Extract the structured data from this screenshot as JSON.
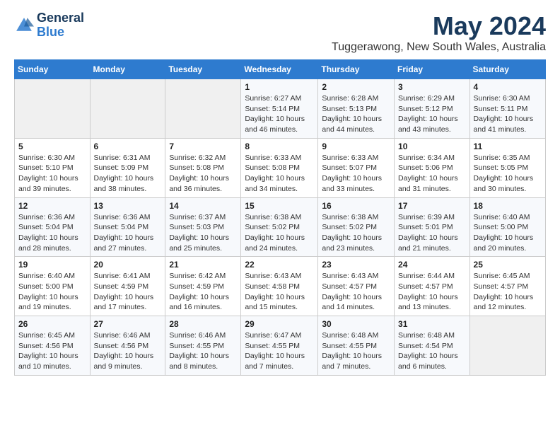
{
  "header": {
    "logo_line1": "General",
    "logo_line2": "Blue",
    "title": "May 2024",
    "subtitle": "Tuggerawong, New South Wales, Australia"
  },
  "weekdays": [
    "Sunday",
    "Monday",
    "Tuesday",
    "Wednesday",
    "Thursday",
    "Friday",
    "Saturday"
  ],
  "weeks": [
    [
      {
        "day": "",
        "info": ""
      },
      {
        "day": "",
        "info": ""
      },
      {
        "day": "",
        "info": ""
      },
      {
        "day": "1",
        "info": "Sunrise: 6:27 AM\nSunset: 5:14 PM\nDaylight: 10 hours\nand 46 minutes."
      },
      {
        "day": "2",
        "info": "Sunrise: 6:28 AM\nSunset: 5:13 PM\nDaylight: 10 hours\nand 44 minutes."
      },
      {
        "day": "3",
        "info": "Sunrise: 6:29 AM\nSunset: 5:12 PM\nDaylight: 10 hours\nand 43 minutes."
      },
      {
        "day": "4",
        "info": "Sunrise: 6:30 AM\nSunset: 5:11 PM\nDaylight: 10 hours\nand 41 minutes."
      }
    ],
    [
      {
        "day": "5",
        "info": "Sunrise: 6:30 AM\nSunset: 5:10 PM\nDaylight: 10 hours\nand 39 minutes."
      },
      {
        "day": "6",
        "info": "Sunrise: 6:31 AM\nSunset: 5:09 PM\nDaylight: 10 hours\nand 38 minutes."
      },
      {
        "day": "7",
        "info": "Sunrise: 6:32 AM\nSunset: 5:08 PM\nDaylight: 10 hours\nand 36 minutes."
      },
      {
        "day": "8",
        "info": "Sunrise: 6:33 AM\nSunset: 5:08 PM\nDaylight: 10 hours\nand 34 minutes."
      },
      {
        "day": "9",
        "info": "Sunrise: 6:33 AM\nSunset: 5:07 PM\nDaylight: 10 hours\nand 33 minutes."
      },
      {
        "day": "10",
        "info": "Sunrise: 6:34 AM\nSunset: 5:06 PM\nDaylight: 10 hours\nand 31 minutes."
      },
      {
        "day": "11",
        "info": "Sunrise: 6:35 AM\nSunset: 5:05 PM\nDaylight: 10 hours\nand 30 minutes."
      }
    ],
    [
      {
        "day": "12",
        "info": "Sunrise: 6:36 AM\nSunset: 5:04 PM\nDaylight: 10 hours\nand 28 minutes."
      },
      {
        "day": "13",
        "info": "Sunrise: 6:36 AM\nSunset: 5:04 PM\nDaylight: 10 hours\nand 27 minutes."
      },
      {
        "day": "14",
        "info": "Sunrise: 6:37 AM\nSunset: 5:03 PM\nDaylight: 10 hours\nand 25 minutes."
      },
      {
        "day": "15",
        "info": "Sunrise: 6:38 AM\nSunset: 5:02 PM\nDaylight: 10 hours\nand 24 minutes."
      },
      {
        "day": "16",
        "info": "Sunrise: 6:38 AM\nSunset: 5:02 PM\nDaylight: 10 hours\nand 23 minutes."
      },
      {
        "day": "17",
        "info": "Sunrise: 6:39 AM\nSunset: 5:01 PM\nDaylight: 10 hours\nand 21 minutes."
      },
      {
        "day": "18",
        "info": "Sunrise: 6:40 AM\nSunset: 5:00 PM\nDaylight: 10 hours\nand 20 minutes."
      }
    ],
    [
      {
        "day": "19",
        "info": "Sunrise: 6:40 AM\nSunset: 5:00 PM\nDaylight: 10 hours\nand 19 minutes."
      },
      {
        "day": "20",
        "info": "Sunrise: 6:41 AM\nSunset: 4:59 PM\nDaylight: 10 hours\nand 17 minutes."
      },
      {
        "day": "21",
        "info": "Sunrise: 6:42 AM\nSunset: 4:59 PM\nDaylight: 10 hours\nand 16 minutes."
      },
      {
        "day": "22",
        "info": "Sunrise: 6:43 AM\nSunset: 4:58 PM\nDaylight: 10 hours\nand 15 minutes."
      },
      {
        "day": "23",
        "info": "Sunrise: 6:43 AM\nSunset: 4:57 PM\nDaylight: 10 hours\nand 14 minutes."
      },
      {
        "day": "24",
        "info": "Sunrise: 6:44 AM\nSunset: 4:57 PM\nDaylight: 10 hours\nand 13 minutes."
      },
      {
        "day": "25",
        "info": "Sunrise: 6:45 AM\nSunset: 4:57 PM\nDaylight: 10 hours\nand 12 minutes."
      }
    ],
    [
      {
        "day": "26",
        "info": "Sunrise: 6:45 AM\nSunset: 4:56 PM\nDaylight: 10 hours\nand 10 minutes."
      },
      {
        "day": "27",
        "info": "Sunrise: 6:46 AM\nSunset: 4:56 PM\nDaylight: 10 hours\nand 9 minutes."
      },
      {
        "day": "28",
        "info": "Sunrise: 6:46 AM\nSunset: 4:55 PM\nDaylight: 10 hours\nand 8 minutes."
      },
      {
        "day": "29",
        "info": "Sunrise: 6:47 AM\nSunset: 4:55 PM\nDaylight: 10 hours\nand 7 minutes."
      },
      {
        "day": "30",
        "info": "Sunrise: 6:48 AM\nSunset: 4:55 PM\nDaylight: 10 hours\nand 7 minutes."
      },
      {
        "day": "31",
        "info": "Sunrise: 6:48 AM\nSunset: 4:54 PM\nDaylight: 10 hours\nand 6 minutes."
      },
      {
        "day": "",
        "info": ""
      }
    ]
  ]
}
